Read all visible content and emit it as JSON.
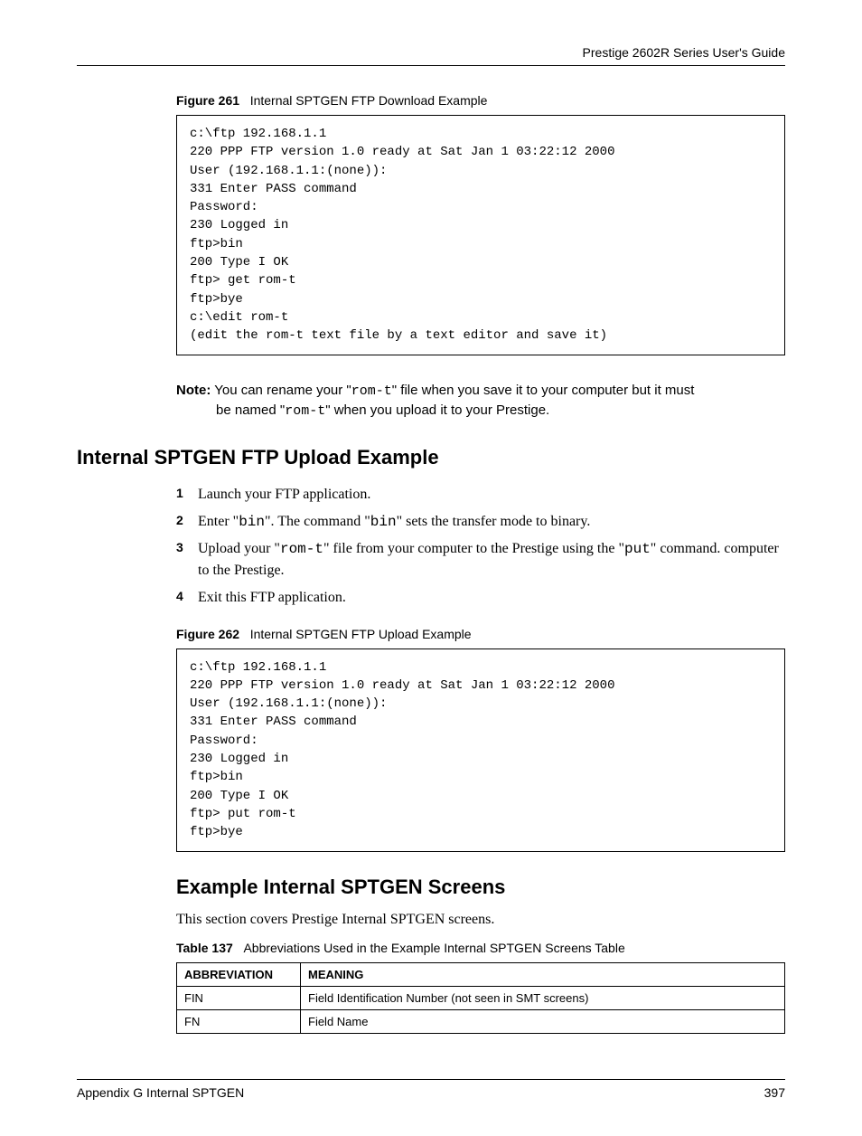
{
  "header": {
    "guide_title": "Prestige 2602R Series User's Guide"
  },
  "figure261": {
    "label": "Figure 261",
    "title": "Internal SPTGEN FTP Download Example",
    "code": "c:\\ftp 192.168.1.1\n220 PPP FTP version 1.0 ready at Sat Jan 1 03:22:12 2000\nUser (192.168.1.1:(none)):\n331 Enter PASS command\nPassword:\n230 Logged in\nftp>bin\n200 Type I OK\nftp> get rom-t\nftp>bye\nc:\\edit rom-t\n(edit the rom-t text file by a text editor and save it)"
  },
  "note": {
    "label": "Note:",
    "line1_a": " You can rename your \"",
    "line1_code1": "rom-t",
    "line1_b": "\" file when you save it to your computer but it must",
    "line2_a": "be named \"",
    "line2_code": "rom-t",
    "line2_b": "\" when you upload it to your Prestige."
  },
  "section1": {
    "heading": "Internal SPTGEN FTP Upload Example",
    "steps": [
      {
        "num": "1",
        "parts": [
          {
            "t": "text",
            "v": "Launch your FTP application."
          }
        ]
      },
      {
        "num": "2",
        "parts": [
          {
            "t": "text",
            "v": "Enter \""
          },
          {
            "t": "mono",
            "v": "bin"
          },
          {
            "t": "text",
            "v": "\". The command \""
          },
          {
            "t": "mono",
            "v": "bin"
          },
          {
            "t": "text",
            "v": "\" sets the transfer mode to binary."
          }
        ]
      },
      {
        "num": "3",
        "parts": [
          {
            "t": "text",
            "v": "Upload your \""
          },
          {
            "t": "mono",
            "v": "rom-t"
          },
          {
            "t": "text",
            "v": "\" file from your computer to the Prestige using the \""
          },
          {
            "t": "mono",
            "v": "put"
          },
          {
            "t": "text",
            "v": "\" command. computer to the Prestige."
          }
        ]
      },
      {
        "num": "4",
        "parts": [
          {
            "t": "text",
            "v": "Exit this FTP application."
          }
        ]
      }
    ]
  },
  "figure262": {
    "label": "Figure 262",
    "title": "Internal SPTGEN FTP Upload Example",
    "code": "c:\\ftp 192.168.1.1\n220 PPP FTP version 1.0 ready at Sat Jan 1 03:22:12 2000\nUser (192.168.1.1:(none)):\n331 Enter PASS command\nPassword:\n230 Logged in\nftp>bin\n200 Type I OK\nftp> put rom-t\nftp>bye"
  },
  "section2": {
    "heading": "Example Internal SPTGEN Screens",
    "paragraph": "This section covers Prestige Internal SPTGEN screens."
  },
  "table137": {
    "label": "Table 137",
    "title": "Abbreviations Used in the Example Internal SPTGEN Screens Table",
    "headers": [
      "ABBREVIATION",
      "MEANING"
    ],
    "rows": [
      [
        "FIN",
        "Field Identification Number (not seen in SMT screens)"
      ],
      [
        "FN",
        "Field Name"
      ]
    ]
  },
  "footer": {
    "appendix": "Appendix G Internal SPTGEN",
    "page": "397"
  }
}
